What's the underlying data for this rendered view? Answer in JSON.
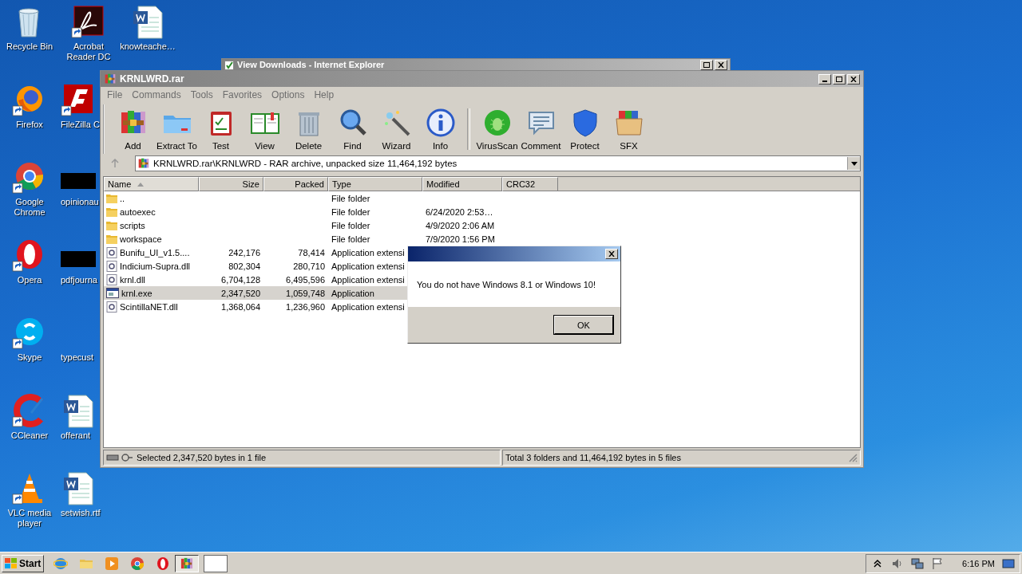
{
  "desktop_icons": [
    {
      "label": "Recycle Bin"
    },
    {
      "label": "Firefox"
    },
    {
      "label": "Google Chrome"
    },
    {
      "label": "Opera"
    },
    {
      "label": "Skype"
    },
    {
      "label": "CCleaner"
    },
    {
      "label": "VLC media player"
    },
    {
      "label": "Acrobat Reader DC"
    },
    {
      "label": "FileZilla C"
    },
    {
      "label": "opinionau"
    },
    {
      "label": "pdfjourna"
    },
    {
      "label": "typecust"
    },
    {
      "label": "offerant"
    },
    {
      "label": "setwish.rtf"
    },
    {
      "label": "knowteache…"
    }
  ],
  "background_window": {
    "title": "View Downloads - Internet Explorer"
  },
  "window": {
    "title": "KRNLWRD.rar",
    "menu": [
      "File",
      "Commands",
      "Tools",
      "Favorites",
      "Options",
      "Help"
    ],
    "toolbar_groups": [
      [
        "Add",
        "Extract To",
        "Test",
        "View",
        "Delete",
        "Find",
        "Wizard",
        "Info"
      ],
      [
        "VirusScan",
        "Comment",
        "Protect",
        "SFX"
      ]
    ],
    "address": "KRNLWRD.rar\\KRNLWRD - RAR archive, unpacked size 11,464,192 bytes",
    "columns": [
      {
        "label": "Name",
        "sorted": true
      },
      {
        "label": "Size",
        "sorted": false
      },
      {
        "label": "Packed",
        "sorted": false
      },
      {
        "label": "Type",
        "sorted": false
      },
      {
        "label": "Modified",
        "sorted": false
      },
      {
        "label": "CRC32",
        "sorted": false
      }
    ],
    "rows": [
      {
        "kind": "folder",
        "name": "..",
        "type": "File folder",
        "selected": false
      },
      {
        "kind": "folder",
        "name": "autoexec",
        "type": "File folder",
        "modified": "6/24/2020 2:53…",
        "selected": false
      },
      {
        "kind": "folder",
        "name": "scripts",
        "type": "File folder",
        "modified": "4/9/2020 2:06 AM",
        "selected": false
      },
      {
        "kind": "folder",
        "name": "workspace",
        "type": "File folder",
        "modified": "7/9/2020 1:56 PM",
        "selected": false
      },
      {
        "kind": "library",
        "name": "Bunifu_UI_v1.5....",
        "size": "242,176",
        "packed": "78,414",
        "type": "Application extensi",
        "selected": false
      },
      {
        "kind": "library",
        "name": "Indicium-Supra.dll",
        "size": "802,304",
        "packed": "280,710",
        "type": "Application extensi",
        "selected": false
      },
      {
        "kind": "library",
        "name": "krnl.dll",
        "size": "6,704,128",
        "packed": "6,495,596",
        "type": "Application extensi",
        "selected": false
      },
      {
        "kind": "program",
        "name": "krnl.exe",
        "size": "2,347,520",
        "packed": "1,059,748",
        "type": "Application",
        "selected": true
      },
      {
        "kind": "library",
        "name": "ScintillaNET.dll",
        "size": "1,368,064",
        "packed": "1,236,960",
        "type": "Application extensi",
        "selected": false
      }
    ],
    "status_left": "Selected 2,347,520 bytes in 1 file",
    "status_right": "Total 3 folders and 11,464,192 bytes in 5 files"
  },
  "dialog": {
    "message": "You do not have Windows 8.1 or Windows 10!",
    "buttons": [
      "OK"
    ]
  },
  "taskbar": {
    "start": "Start",
    "clock": "6:16 PM"
  }
}
